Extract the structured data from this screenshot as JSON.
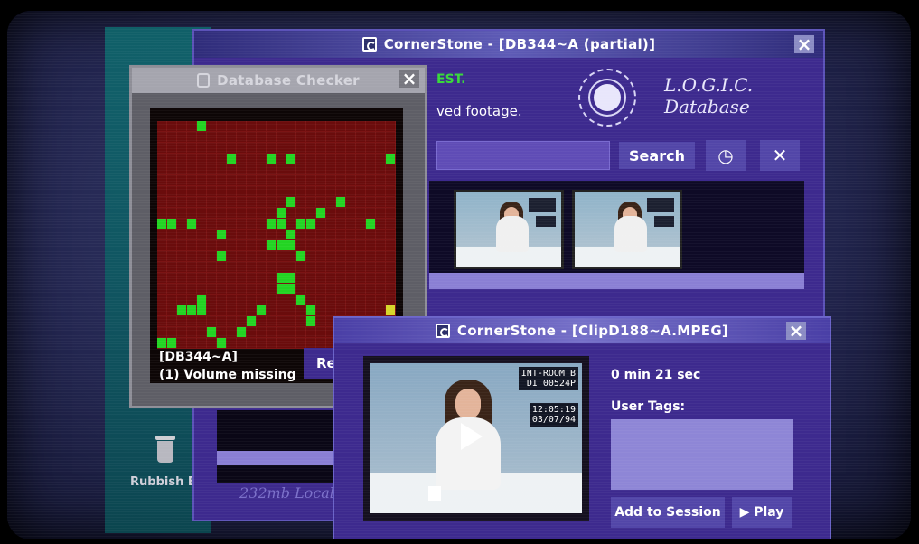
{
  "main_window": {
    "title": "CornerStone - [DB344~A (partial)]",
    "welcome_highlight": "EST.",
    "welcome_sub": "ved footage.",
    "logo_line1": "L.O.G.I.C.",
    "logo_line2": "Database",
    "search_label": "Search",
    "storage_text": "232mb Local",
    "icons": {
      "history": "clock-icon",
      "tools": "tools-icon"
    }
  },
  "checker": {
    "title": "Database Checker",
    "db_id": "[DB344~A]",
    "message": "(1) Volume missing",
    "button_label": "Re",
    "colors": {
      "on": "#23d423",
      "warn": "#d6d62a",
      "off": "#6a0c0c"
    },
    "on_cells": [
      [
        0,
        4
      ],
      [
        3,
        7
      ],
      [
        3,
        11
      ],
      [
        3,
        13
      ],
      [
        3,
        23
      ],
      [
        7,
        13
      ],
      [
        7,
        18
      ],
      [
        8,
        12
      ],
      [
        8,
        16
      ],
      [
        9,
        0
      ],
      [
        9,
        1
      ],
      [
        9,
        3
      ],
      [
        9,
        11
      ],
      [
        9,
        12
      ],
      [
        9,
        14
      ],
      [
        9,
        15
      ],
      [
        9,
        21
      ],
      [
        10,
        6
      ],
      [
        10,
        13
      ],
      [
        11,
        11
      ],
      [
        11,
        12
      ],
      [
        11,
        13
      ],
      [
        12,
        14
      ],
      [
        12,
        6
      ],
      [
        14,
        13
      ],
      [
        14,
        12
      ],
      [
        15,
        12
      ],
      [
        15,
        13
      ],
      [
        16,
        14
      ],
      [
        16,
        4
      ],
      [
        17,
        2
      ],
      [
        17,
        3
      ],
      [
        17,
        4
      ],
      [
        17,
        10
      ],
      [
        17,
        15
      ],
      [
        18,
        9
      ],
      [
        18,
        15
      ],
      [
        19,
        5
      ],
      [
        19,
        8
      ],
      [
        20,
        0
      ],
      [
        20,
        1
      ],
      [
        20,
        6
      ]
    ],
    "warn_cells": [
      [
        17,
        23
      ],
      [
        18,
        23
      ]
    ]
  },
  "clip_window": {
    "title": "CornerStone - [ClipD188~A.MPEG]",
    "osd_room": "INT-ROOM B",
    "osd_id": "DI 00524P",
    "osd_time": "12:05:19",
    "osd_date": "03/07/94",
    "duration": "0 min 21 sec",
    "tags_label": "User Tags:",
    "add_button": "Add to Session",
    "play_button": "▶ Play"
  },
  "thumbnails": [
    {
      "osd": "INTROOM B"
    },
    {
      "osd": "INTROOM B"
    }
  ],
  "desktop": {
    "rubbish_label": "Rubbish B"
  }
}
